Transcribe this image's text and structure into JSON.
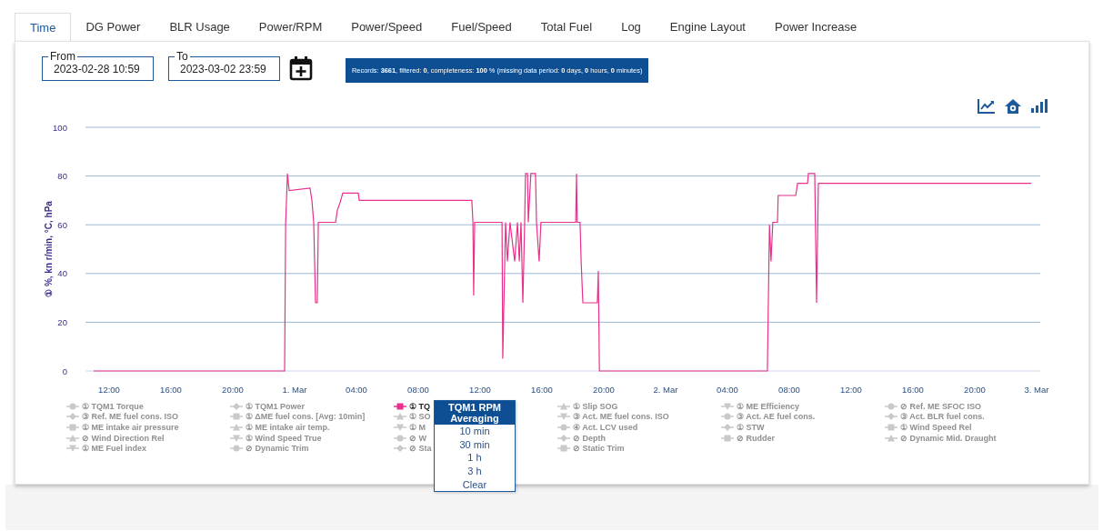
{
  "tabs": [
    {
      "label": "Time",
      "selected": true
    },
    {
      "label": "DG Power",
      "selected": false
    },
    {
      "label": "BLR Usage",
      "selected": false
    },
    {
      "label": "Power/RPM",
      "selected": false
    },
    {
      "label": "Power/Speed",
      "selected": false
    },
    {
      "label": "Fuel/Speed",
      "selected": false
    },
    {
      "label": "Total Fuel",
      "selected": false
    },
    {
      "label": "Log",
      "selected": false
    },
    {
      "label": "Engine Layout",
      "selected": false
    },
    {
      "label": "Power Increase",
      "selected": false
    }
  ],
  "filters": {
    "from": {
      "label": "From",
      "value": "2023-02-28 10:59"
    },
    "to": {
      "label": "To",
      "value": "2023-03-02 23:59"
    }
  },
  "summary": "Records: **3661**, filtered: **0**, completeness: **100** % (missing data period: **0** days, **0** hours, **0** minutes)",
  "chart": {
    "chart_data": {
      "type": "line",
      "ylabel": "① %, kn r/min, °C, hPa",
      "grid": true,
      "x": [
        "2023-02-28 11:00",
        "2023-02-28 23:21",
        "2023-02-28 23:25",
        "2023-02-28 23:32",
        "2023-02-28 23:39",
        "2023-03-01 01:00",
        "2023-03-01 01:07",
        "2023-03-01 01:14",
        "2023-03-01 01:21",
        "2023-03-01 01:28",
        "2023-03-01 01:32",
        "2023-03-01 02:39",
        "2023-03-01 02:46",
        "2023-03-01 02:56",
        "2023-03-01 03:07",
        "2023-03-01 04:07",
        "2023-03-01 04:11",
        "2023-03-01 11:28",
        "2023-03-01 11:32",
        "2023-03-01 11:35",
        "2023-03-01 11:39",
        "2023-03-01 13:25",
        "2023-03-01 13:28",
        "2023-03-01 13:39",
        "2023-03-01 13:46",
        "2023-03-01 13:56",
        "2023-03-01 14:14",
        "2023-03-01 14:25",
        "2023-03-01 14:32",
        "2023-03-01 14:39",
        "2023-03-01 14:46",
        "2023-03-01 14:53",
        "2023-03-01 14:56",
        "2023-03-01 15:04",
        "2023-03-01 15:07",
        "2023-03-01 15:17",
        "2023-03-01 15:35",
        "2023-03-01 15:39",
        "2023-03-01 15:49",
        "2023-03-01 15:56",
        "2023-03-01 18:11",
        "2023-03-01 18:14",
        "2023-03-01 18:17",
        "2023-03-01 18:28",
        "2023-03-01 18:32",
        "2023-03-01 18:39",
        "2023-03-01 19:35",
        "2023-03-01 19:39",
        "2023-03-01 19:43",
        "2023-03-01 19:49",
        "2023-03-02 06:35",
        "2023-03-02 06:43",
        "2023-03-02 06:49",
        "2023-03-02 06:56",
        "2023-03-02 07:14",
        "2023-03-02 07:17",
        "2023-03-02 08:25",
        "2023-03-02 08:32",
        "2023-03-02 09:11",
        "2023-03-02 09:14",
        "2023-03-02 09:39",
        "2023-03-02 09:46",
        "2023-03-02 09:53",
        "2023-03-02 23:39"
      ],
      "series": [
        {
          "name": "TQM1 RPM",
          "color": "#e8308c",
          "values": [
            0,
            0,
            60,
            81,
            74,
            75,
            70,
            61,
            28,
            28,
            61,
            61,
            66,
            69,
            73,
            73,
            70,
            70,
            61,
            31,
            61,
            61,
            5,
            61,
            45,
            61,
            45,
            61,
            45,
            61,
            28,
            61,
            81,
            81,
            61,
            81,
            81,
            61,
            45,
            61,
            61,
            81,
            61,
            61,
            45,
            28,
            28,
            41,
            0,
            0,
            0,
            60,
            45,
            61,
            61,
            72,
            72,
            77,
            77,
            81,
            81,
            28,
            77,
            77
          ]
        }
      ],
      "xlim": [
        "2023-02-28 10:28",
        "2023-03-03 00:14"
      ],
      "ylim": [
        0,
        100
      ],
      "xticks": [
        {
          "value": "2023-02-28 12:00",
          "label": "12:00"
        },
        {
          "value": "2023-02-28 16:00",
          "label": "16:00"
        },
        {
          "value": "2023-02-28 20:00",
          "label": "20:00"
        },
        {
          "value": "2023-03-01 00:00",
          "label": "1. Mar"
        },
        {
          "value": "2023-03-01 04:00",
          "label": "04:00"
        },
        {
          "value": "2023-03-01 08:00",
          "label": "08:00"
        },
        {
          "value": "2023-03-01 12:00",
          "label": "12:00"
        },
        {
          "value": "2023-03-01 16:00",
          "label": "16:00"
        },
        {
          "value": "2023-03-01 20:00",
          "label": "20:00"
        },
        {
          "value": "2023-03-02 00:00",
          "label": "2. Mar"
        },
        {
          "value": "2023-03-02 04:00",
          "label": "04:00"
        },
        {
          "value": "2023-03-02 08:00",
          "label": "08:00"
        },
        {
          "value": "2023-03-02 12:00",
          "label": "12:00"
        },
        {
          "value": "2023-03-02 16:00",
          "label": "16:00"
        },
        {
          "value": "2023-03-02 20:00",
          "label": "20:00"
        },
        {
          "value": "2023-03-03 00:00",
          "label": "3. Mar"
        }
      ],
      "yticks": [
        0,
        20,
        40,
        60,
        80,
        100
      ]
    }
  },
  "legend": [
    [
      {
        "kind": "circle",
        "badge": "①",
        "label": "TQM1 Torque",
        "visible": false
      },
      {
        "kind": "diamond",
        "badge": "③",
        "label": "Ref. ME fuel cons. ISO",
        "visible": false
      },
      {
        "kind": "square",
        "badge": "①",
        "label": "ME intake air pressure",
        "visible": false
      },
      {
        "kind": "triangle",
        "badge": "⊘",
        "label": "Wind Direction Rel",
        "visible": false
      },
      {
        "kind": "triangle-down",
        "badge": "①",
        "label": "ME Fuel index",
        "visible": false
      }
    ],
    [
      {
        "kind": "diamond",
        "badge": "①",
        "label": "TQM1 Power",
        "visible": false
      },
      {
        "kind": "square",
        "badge": "①",
        "label": "ΔME fuel cons. [Avg: 10min]",
        "visible": false
      },
      {
        "kind": "triangle",
        "badge": "①",
        "label": "ME intake air temp.",
        "visible": false
      },
      {
        "kind": "triangle-down",
        "badge": "①",
        "label": "Wind Speed True",
        "visible": false
      },
      {
        "kind": "circle",
        "badge": "⊘",
        "label": "Dynamic Trim",
        "visible": false
      }
    ],
    [
      {
        "kind": "square",
        "badge": "①",
        "label": "TQ",
        "visible": true
      },
      {
        "kind": "triangle",
        "badge": "①",
        "label": "SO",
        "visible": false
      },
      {
        "kind": "triangle-down",
        "badge": "①",
        "label": "M",
        "visible": false
      },
      {
        "kind": "circle",
        "badge": "⊘",
        "label": "W",
        "visible": false
      },
      {
        "kind": "diamond",
        "badge": "⊘",
        "label": "Sta",
        "visible": false
      }
    ],
    [
      {
        "kind": "triangle",
        "badge": "①",
        "label": "Slip SOG",
        "visible": false
      },
      {
        "kind": "triangle-down",
        "badge": "③",
        "label": "Act. ME fuel cons. ISO",
        "visible": false
      },
      {
        "kind": "circle",
        "badge": "④",
        "label": "Act. LCV used",
        "visible": false
      },
      {
        "kind": "diamond",
        "badge": "⊘",
        "label": "Depth",
        "visible": false
      },
      {
        "kind": "square",
        "badge": "⊘",
        "label": "Static Trim",
        "visible": false
      }
    ],
    [
      {
        "kind": "triangle-down",
        "badge": "①",
        "label": "ME Efficiency",
        "visible": false
      },
      {
        "kind": "circle",
        "badge": "③",
        "label": "Act. AE fuel cons.",
        "visible": false
      },
      {
        "kind": "diamond",
        "badge": "①",
        "label": "STW",
        "visible": false
      },
      {
        "kind": "square",
        "badge": "⊘",
        "label": "Rudder",
        "visible": false
      }
    ],
    [
      {
        "kind": "circle",
        "badge": "⊘",
        "label": "Ref. ME SFOC ISO",
        "visible": false
      },
      {
        "kind": "diamond",
        "badge": "③",
        "label": "Act. BLR fuel cons.",
        "visible": false
      },
      {
        "kind": "square",
        "badge": "①",
        "label": "Wind Speed Rel",
        "visible": false
      },
      {
        "kind": "triangle",
        "badge": "⊘",
        "label": "Dynamic Mid. Draught",
        "visible": false
      }
    ]
  ],
  "averaging_menu": {
    "title": "Averaging",
    "options": [
      "10 min",
      "30 min",
      "1 h",
      "3 h",
      "Clear"
    ]
  }
}
